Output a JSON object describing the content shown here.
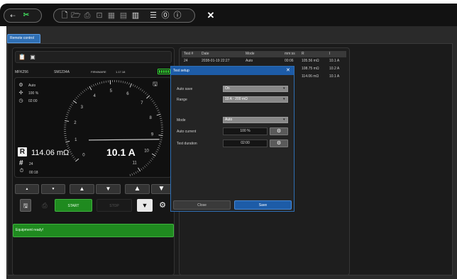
{
  "toolbar": {
    "icons": [
      "connect-plug-icon",
      "new-file-icon",
      "open-folder-icon",
      "print-icon",
      "print-preview-icon",
      "report-icon",
      "export-icon",
      "list-icon",
      "settings-icon",
      "help-icon",
      "info-icon",
      "close-icon"
    ]
  },
  "tab": {
    "label": "Remote control"
  },
  "device": {
    "model": "MFK256",
    "serial": "SM1234A",
    "firmware_label": "FIRMWARE",
    "firmware_version": "1.17.18",
    "mode": "Auto",
    "current_percent": "100 %",
    "duration": "02:00",
    "resistance_badge": "R",
    "resistance": "114.06 mΩ",
    "current": "10.1 A",
    "count_badge": "#",
    "count": "24",
    "elapsed": "00:18",
    "battery_color": "#2fd62f"
  },
  "gauge": {
    "ticks": [
      "1",
      "2",
      "3",
      "4",
      "5",
      "6",
      "7",
      "8",
      "9",
      "10",
      "11",
      "0"
    ],
    "needle_value": 9.2
  },
  "controls": {
    "start_label": "START",
    "stop_label": "STOP"
  },
  "status": {
    "message": "Equipment ready!"
  },
  "results": {
    "headers": [
      "Test #",
      "Date",
      "Mode",
      "mm:ss",
      "R",
      "I"
    ],
    "rows": [
      [
        "24",
        "2038-01-19 22:27",
        "Auto",
        "00:06",
        "105.56 mΩ",
        "10.1 A"
      ],
      [
        "",
        "",
        "",
        "",
        "108.75 mΩ",
        "10.2 A"
      ],
      [
        "",
        "",
        "",
        "",
        "114.06 mΩ",
        "10.1 A"
      ]
    ]
  },
  "dialog": {
    "title": "Test setup",
    "auto_save_label": "Auto save",
    "auto_save_value": "On",
    "range_label": "Range",
    "range_value": "10 A - 200 mΩ",
    "mode_label": "Mode",
    "mode_value": "Auto",
    "auto_current_label": "Auto current",
    "auto_current_value": "100 %",
    "test_duration_label": "Test duration",
    "test_duration_value": "02:00",
    "close_label": "Close",
    "save_label": "Save"
  }
}
